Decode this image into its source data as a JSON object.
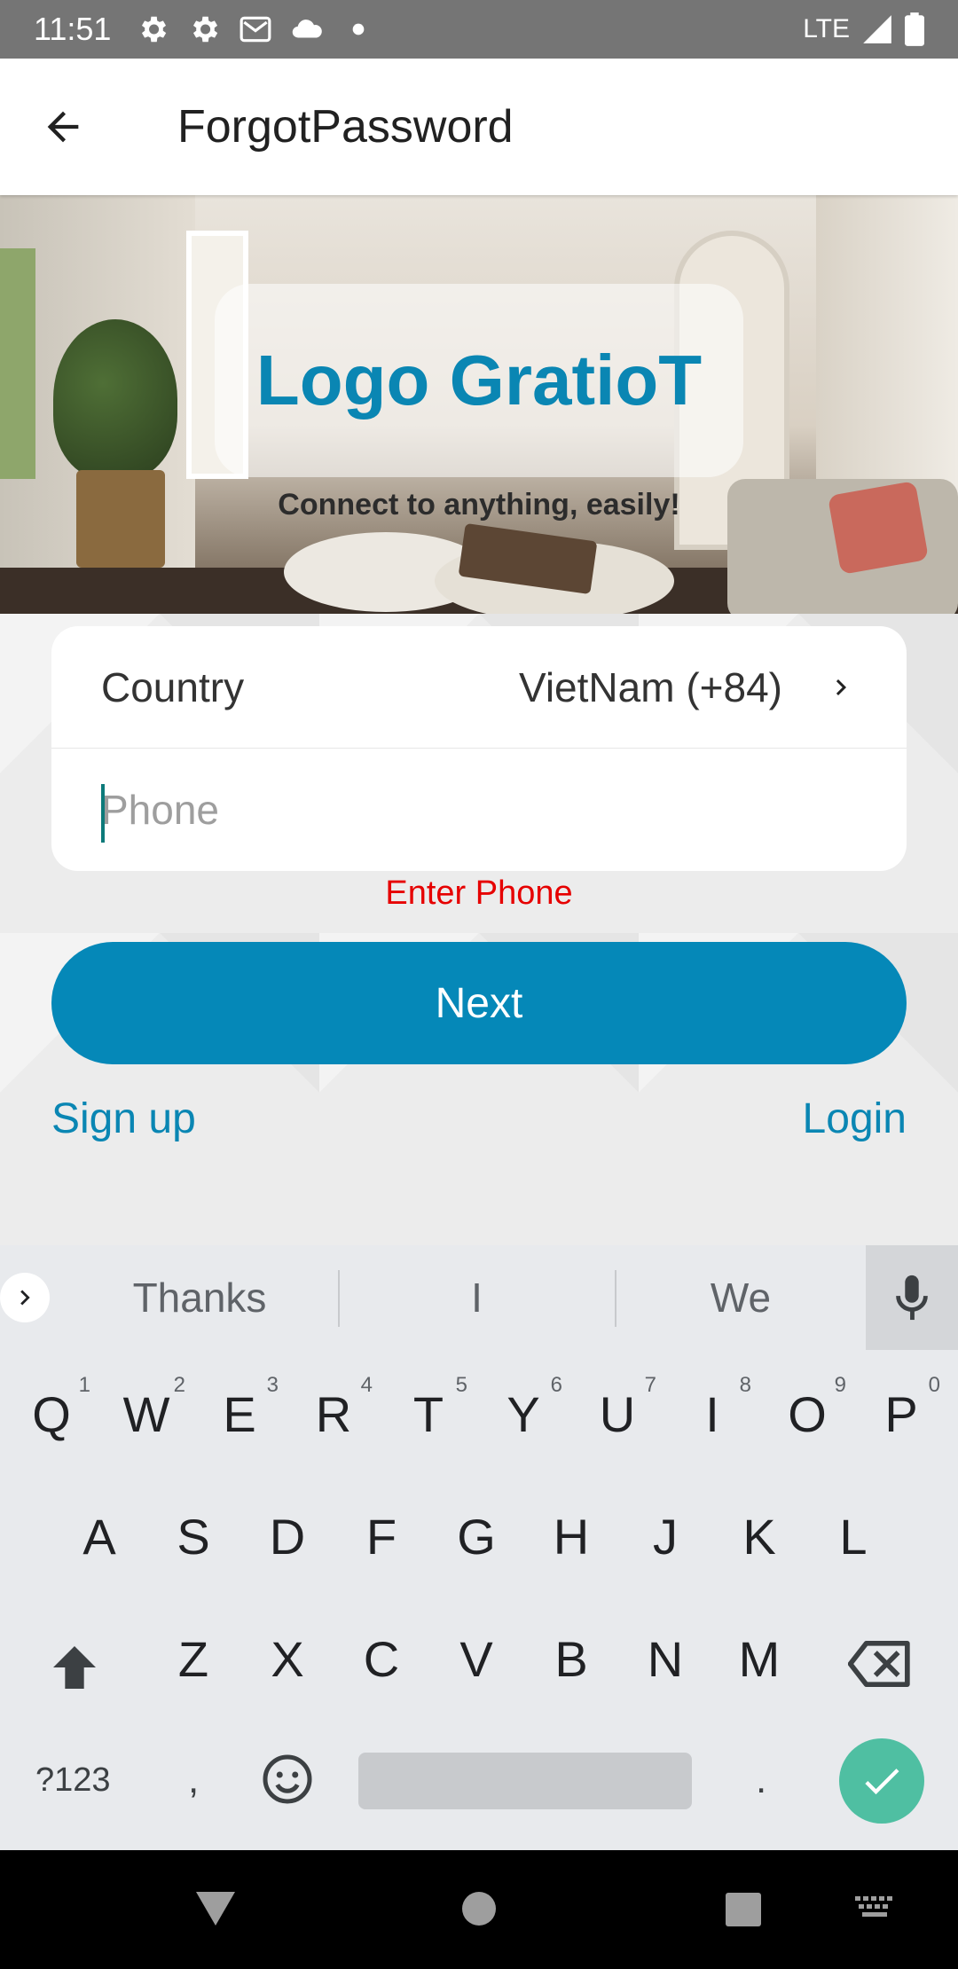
{
  "status_bar": {
    "time": "11:51",
    "network": "LTE",
    "icons": [
      "settings-icon",
      "settings-icon",
      "gmail-icon",
      "cloud-icon",
      "dot-icon",
      "signal-icon",
      "battery-icon"
    ]
  },
  "app_bar": {
    "title": "ForgotPassword",
    "back_icon": "arrow-back-icon"
  },
  "hero": {
    "logo_text": "Logo GratioT",
    "tagline": "Connect to anything, easily!"
  },
  "form": {
    "country_label": "Country",
    "country_value": "VietNam (+84)",
    "phone_placeholder": "Phone",
    "phone_value": "",
    "error": "Enter Phone"
  },
  "actions": {
    "next_label": "Next",
    "signup_label": "Sign up",
    "login_label": "Login"
  },
  "keyboard": {
    "suggestions": [
      "Thanks",
      "I",
      "We"
    ],
    "row1": [
      {
        "key": "Q",
        "hint": "1"
      },
      {
        "key": "W",
        "hint": "2"
      },
      {
        "key": "E",
        "hint": "3"
      },
      {
        "key": "R",
        "hint": "4"
      },
      {
        "key": "T",
        "hint": "5"
      },
      {
        "key": "Y",
        "hint": "6"
      },
      {
        "key": "U",
        "hint": "7"
      },
      {
        "key": "I",
        "hint": "8"
      },
      {
        "key": "O",
        "hint": "9"
      },
      {
        "key": "P",
        "hint": "0"
      }
    ],
    "row2": [
      "A",
      "S",
      "D",
      "F",
      "G",
      "H",
      "J",
      "K",
      "L"
    ],
    "row3": [
      "Z",
      "X",
      "C",
      "V",
      "B",
      "N",
      "M"
    ],
    "symbols_label": "?123",
    "comma": ",",
    "period": "."
  },
  "colors": {
    "accent": "#0a86b3",
    "button": "#0588b8",
    "error": "#e60000",
    "enter_key": "#4fbfa2"
  }
}
